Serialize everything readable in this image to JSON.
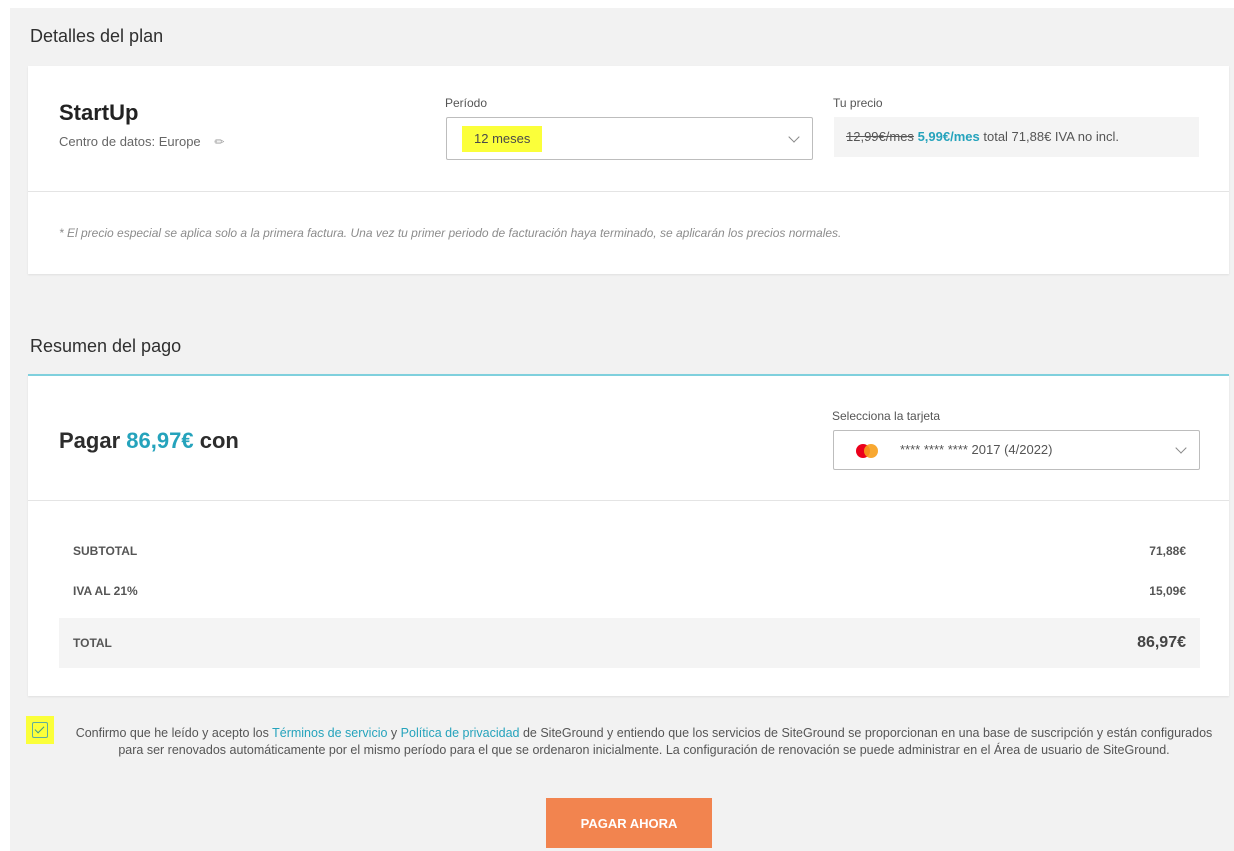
{
  "sections": {
    "plan_title": "Detalles del plan",
    "payment_title": "Resumen del pago"
  },
  "plan": {
    "name": "StartUp",
    "datacenter": "Centro de datos: Europe",
    "period_label": "Período",
    "period_value": "12 meses",
    "price_label": "Tu precio",
    "price_old": "12,99€/mes",
    "price_new": "5,99€/mes",
    "price_total": "total 71,88€ IVA no incl.",
    "note": "* El precio especial se aplica solo a la primera factura. Una vez tu primer periodo de facturación haya terminado, se aplicarán los precios normales."
  },
  "payment": {
    "heading_prefix": "Pagar",
    "amount": "86,97€",
    "heading_suffix": "con",
    "card_label": "Selecciona la tarjeta",
    "card_value": "**** **** **** 2017 (4/2022)",
    "rows": [
      {
        "label": "SUBTOTAL",
        "value": "71,88€"
      },
      {
        "label": "IVA AL 21%",
        "value": "15,09€"
      },
      {
        "label": "TOTAL",
        "value": "86,97€"
      }
    ]
  },
  "consent": {
    "checked": true,
    "text_1": "Confirmo que he leído y acepto los",
    "terms_link": "Términos de servicio",
    "and": "y",
    "privacy_link": "Política de privacidad",
    "text_2": "de SiteGround y entiendo que los servicios de SiteGround se proporcionan en una base de suscripción y están configurados para ser renovados automáticamente por el mismo período para el que se ordenaron inicialmente. La configuración de renovación se puede administrar en el Área de usuario de SiteGround."
  },
  "actions": {
    "pay_button": "PAGAR AHORA"
  },
  "colors": {
    "accent": "#25a3bc",
    "button": "#f2844f",
    "highlight": "#fbff3a"
  },
  "icons": {
    "edit": "pencil-icon",
    "dropdown": "chevron-down-icon",
    "card": "mastercard-icon",
    "check": "checkbox-check-icon"
  }
}
